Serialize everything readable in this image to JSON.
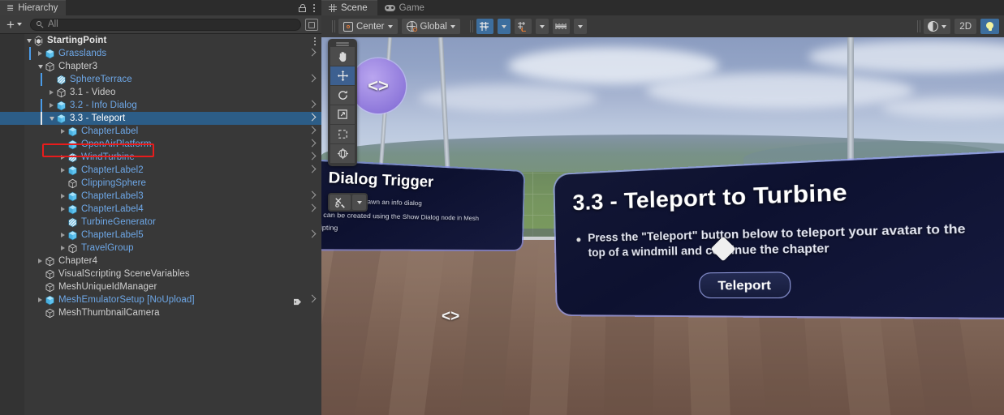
{
  "hierarchy": {
    "tab_label": "Hierarchy",
    "tab_icon": "hierarchy-icon",
    "lock_icon": "lock-icon",
    "menu_icon": "kebab-menu-icon",
    "add_label": "+",
    "search": {
      "placeholder": "All",
      "value": "",
      "icon": "search-icon"
    },
    "popout_icon": "popout-icon",
    "selection_outline_color": "#e81c1c",
    "selected_row_color": "#2c5d87",
    "prefab_text_color": "#6ea8e8",
    "rows": [
      {
        "label": "StartingPoint",
        "depth": 0,
        "icon": "unity-logo-icon",
        "twisty": "down",
        "prefab": false,
        "bold": true,
        "chevron": false,
        "mark": "none",
        "menu": true
      },
      {
        "label": "Grasslands",
        "depth": 1,
        "icon": "prefab-cube-icon",
        "twisty": "right",
        "prefab": true,
        "bold": false,
        "chevron": true,
        "mark": "blue",
        "menu": false
      },
      {
        "label": "Chapter3",
        "depth": 1,
        "icon": "gameobject-cube-icon",
        "twisty": "down",
        "prefab": false,
        "bold": false,
        "chevron": false,
        "mark": "none",
        "menu": false
      },
      {
        "label": "SphereTerrace",
        "depth": 2,
        "icon": "mesh-cube-icon",
        "twisty": "none",
        "prefab": true,
        "bold": false,
        "chevron": true,
        "mark": "blue",
        "menu": false
      },
      {
        "label": "3.1 - Video",
        "depth": 2,
        "icon": "gameobject-cube-icon",
        "twisty": "right",
        "prefab": false,
        "bold": false,
        "chevron": false,
        "mark": "none",
        "menu": false
      },
      {
        "label": "3.2 - Info Dialog",
        "depth": 2,
        "icon": "prefab-cube-icon",
        "twisty": "right",
        "prefab": true,
        "bold": false,
        "chevron": true,
        "mark": "blue",
        "menu": false
      },
      {
        "label": "3.3 - Teleport",
        "depth": 2,
        "icon": "prefab-cube-icon",
        "twisty": "down",
        "prefab": true,
        "bold": false,
        "chevron": true,
        "mark": "white",
        "selected": true,
        "outlined": true,
        "menu": false
      },
      {
        "label": "ChapterLabel",
        "depth": 3,
        "icon": "prefab-cube-icon",
        "twisty": "right",
        "prefab": true,
        "bold": false,
        "chevron": true,
        "mark": "none",
        "menu": false
      },
      {
        "label": "OpenAirPlatform",
        "depth": 3,
        "icon": "prefab-cube-icon",
        "twisty": "none",
        "prefab": true,
        "bold": false,
        "chevron": true,
        "mark": "none",
        "menu": false
      },
      {
        "label": "WindTurbine",
        "depth": 3,
        "icon": "mesh-cube-icon",
        "twisty": "right",
        "prefab": true,
        "bold": false,
        "chevron": true,
        "mark": "none",
        "menu": false
      },
      {
        "label": "ChapterLabel2",
        "depth": 3,
        "icon": "prefab-cube-icon",
        "twisty": "right",
        "prefab": true,
        "bold": false,
        "chevron": true,
        "mark": "none",
        "menu": false
      },
      {
        "label": "ClippingSphere",
        "depth": 3,
        "icon": "gameobject-cube-icon",
        "twisty": "none",
        "prefab": true,
        "bold": false,
        "chevron": false,
        "mark": "none",
        "menu": false
      },
      {
        "label": "ChapterLabel3",
        "depth": 3,
        "icon": "prefab-cube-icon",
        "twisty": "right",
        "prefab": true,
        "bold": false,
        "chevron": true,
        "mark": "none",
        "menu": false
      },
      {
        "label": "ChapterLabel4",
        "depth": 3,
        "icon": "prefab-cube-icon",
        "twisty": "right",
        "prefab": true,
        "bold": false,
        "chevron": true,
        "mark": "none",
        "menu": false
      },
      {
        "label": "TurbineGenerator",
        "depth": 3,
        "icon": "mesh-cube-icon",
        "twisty": "none",
        "prefab": true,
        "bold": false,
        "chevron": false,
        "mark": "none",
        "menu": false
      },
      {
        "label": "ChapterLabel5",
        "depth": 3,
        "icon": "prefab-cube-icon",
        "twisty": "right",
        "prefab": true,
        "bold": false,
        "chevron": true,
        "mark": "none",
        "menu": false
      },
      {
        "label": "TravelGroup",
        "depth": 3,
        "icon": "gameobject-cube-icon",
        "twisty": "right",
        "prefab": true,
        "bold": false,
        "chevron": false,
        "mark": "none",
        "menu": false
      },
      {
        "label": "Chapter4",
        "depth": 1,
        "icon": "gameobject-cube-icon",
        "twisty": "right",
        "prefab": false,
        "bold": false,
        "chevron": false,
        "mark": "none",
        "menu": false
      },
      {
        "label": "VisualScripting SceneVariables",
        "depth": 1,
        "icon": "gameobject-cube-icon",
        "twisty": "none",
        "prefab": false,
        "bold": false,
        "chevron": false,
        "mark": "none",
        "menu": false
      },
      {
        "label": "MeshUniqueIdManager",
        "depth": 1,
        "icon": "gameobject-cube-icon",
        "twisty": "none",
        "prefab": false,
        "bold": false,
        "chevron": false,
        "mark": "none",
        "menu": false
      },
      {
        "label": "MeshEmulatorSetup [NoUpload]",
        "depth": 1,
        "icon": "prefab-cube-icon",
        "twisty": "right",
        "prefab": true,
        "bold": false,
        "chevron": true,
        "mark": "none",
        "tag": true,
        "menu": false
      },
      {
        "label": "MeshThumbnailCamera",
        "depth": 1,
        "icon": "gameobject-cube-icon",
        "twisty": "none",
        "prefab": false,
        "bold": false,
        "chevron": false,
        "mark": "none",
        "menu": false
      }
    ]
  },
  "scene": {
    "tabs": [
      {
        "label": "Scene",
        "icon": "scene-grid-icon",
        "active": true
      },
      {
        "label": "Game",
        "icon": "gamepad-icon",
        "active": false
      }
    ],
    "toolbar": {
      "pivot_label": "Center",
      "pivot_icon": "pivot-center-icon",
      "handle_label": "Global",
      "handle_icon": "globe-icon",
      "grid_toggle_icon": "grid-axis-y-icon",
      "grid_toggle_active": true,
      "grid_dropdown_icon": "chevron-down-icon",
      "snap_icon": "snap-increment-icon",
      "snap_dropdown_icon": "chevron-down-icon",
      "ruler_icon": "ruler-icon",
      "ruler_dropdown_icon": "chevron-down-icon",
      "shading_icon": "shading-mode-icon",
      "shading_dropdown_icon": "chevron-down-icon",
      "view2d_label": "2D",
      "lighting_icon": "lightbulb-icon",
      "lighting_active": true,
      "active_color": "#3d6e9e"
    },
    "tools": [
      {
        "name": "hand-tool",
        "icon": "hand-icon",
        "active": false
      },
      {
        "name": "move-tool",
        "icon": "move-arrows-icon",
        "active": true
      },
      {
        "name": "rotate-tool",
        "icon": "rotate-icon",
        "active": false
      },
      {
        "name": "scale-tool",
        "icon": "scale-icon",
        "active": false
      },
      {
        "name": "rect-tool",
        "icon": "rect-transform-icon",
        "active": false
      },
      {
        "name": "transform-tool",
        "icon": "transform-icon",
        "active": false
      }
    ],
    "custom_tools": {
      "icon": "custom-tools-icon",
      "dropdown_icon": "chevron-down-icon"
    },
    "dialog_main": {
      "title": "3.3 - Teleport to Turbine",
      "bullet": "Press the \"Teleport\" button below to teleport your avatar to the top of a windmill and continue the chapter",
      "button_label": "Teleport"
    },
    "dialog_left": {
      "title": "Dialog Trigger",
      "line1": "button to spawn an info dialog",
      "line2": "dialogs can be created using the Show Dialog  node in Mesh",
      "line3": "ual Scripting"
    },
    "gizmos": [
      {
        "name": "visual-script-gizmo",
        "glyph": "<>"
      },
      {
        "name": "visual-script-gizmo-floor",
        "glyph": "<>"
      }
    ]
  }
}
